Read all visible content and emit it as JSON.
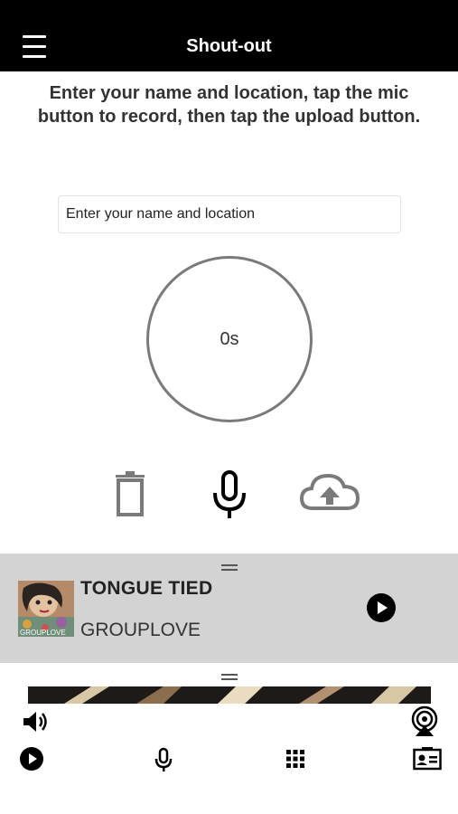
{
  "header": {
    "title": "Shout-out",
    "menu_icon": "hamburger-menu-icon"
  },
  "instructions": "Enter your name and location, tap the mic button to record, then tap the upload button.",
  "name_field": {
    "placeholder": "Enter your name and location",
    "value": ""
  },
  "recorder": {
    "elapsed": "0s"
  },
  "controls": {
    "delete_icon": "trash-icon",
    "record_icon": "microphone-icon",
    "upload_icon": "cloud-upload-icon"
  },
  "now_playing": {
    "title": "TONGUE TIED",
    "artist": "GROUPLOVE",
    "art_text": "GROUPLOVE"
  },
  "bottom_bar": {
    "volume_icon": "volume-icon",
    "airplay_icon": "airplay-icon",
    "tabs": [
      {
        "icon": "play-icon"
      },
      {
        "icon": "microphone-icon"
      },
      {
        "icon": "grid-icon"
      },
      {
        "icon": "contact-card-icon"
      }
    ]
  },
  "colors": {
    "header_bg": "#000000",
    "player_bg": "#d3d3d3",
    "ring": "#7a7a7a"
  }
}
